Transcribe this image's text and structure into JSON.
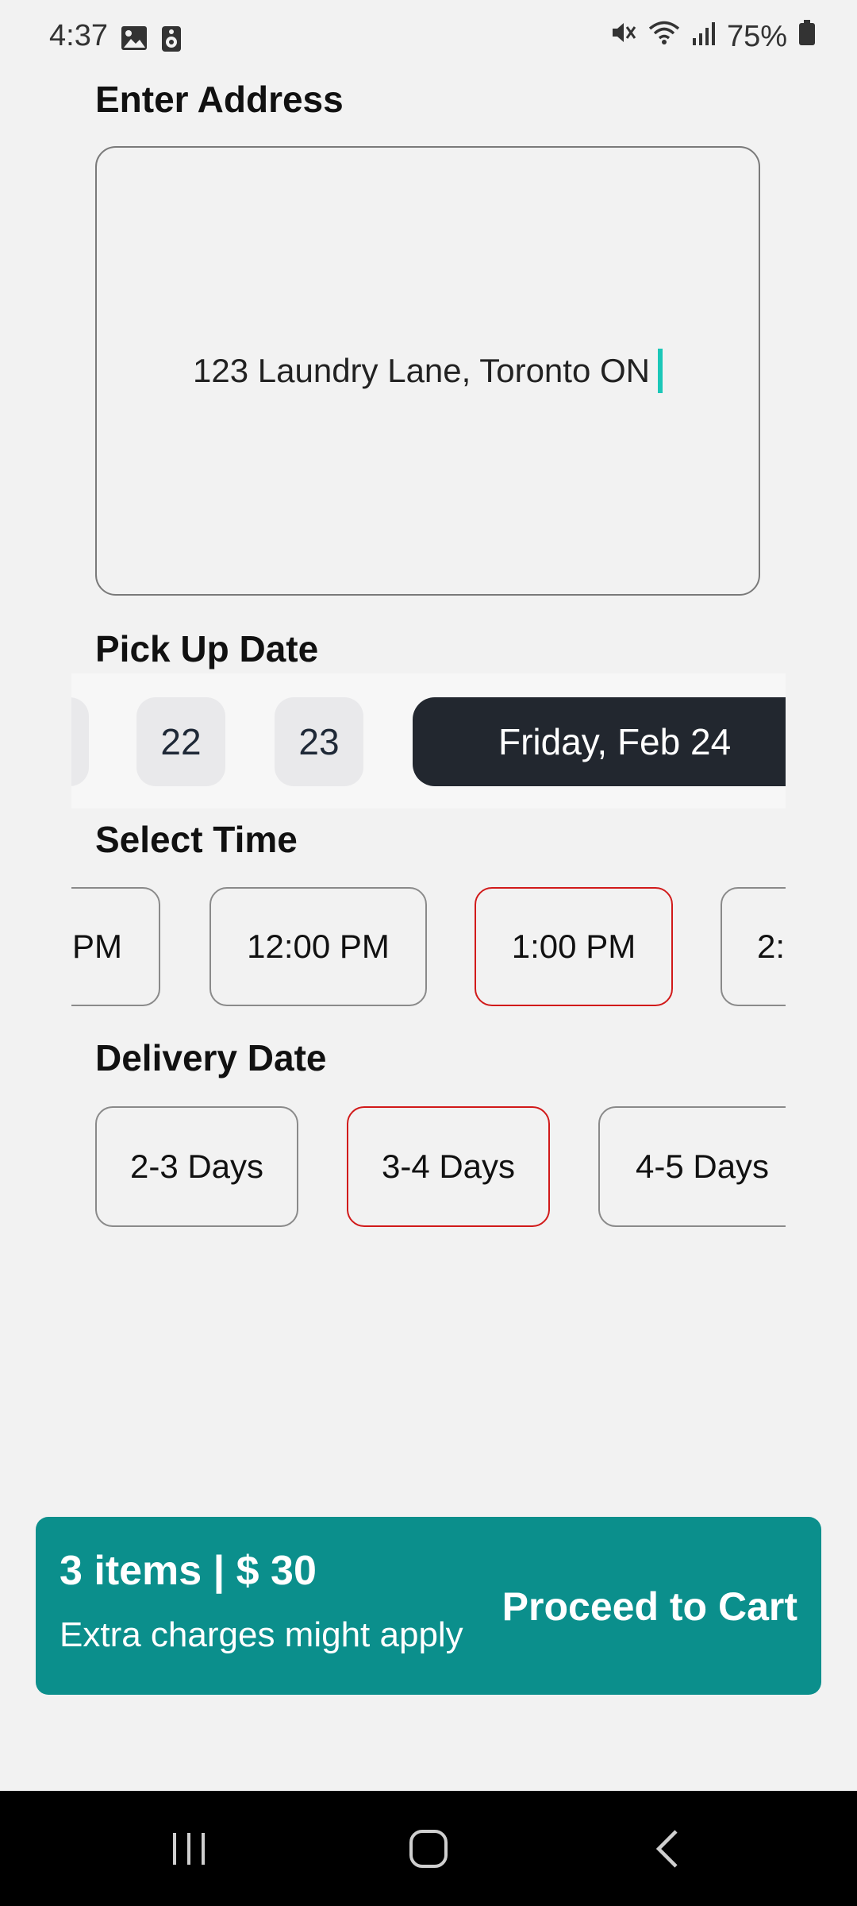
{
  "status_bar": {
    "time": "4:37",
    "battery": "75%",
    "icons_left": [
      "gallery-icon",
      "speaker-icon"
    ],
    "icons_right": [
      "mute-icon",
      "wifi-icon",
      "signal-icon",
      "battery-icon"
    ]
  },
  "address": {
    "title": "Enter Address",
    "value": "123 Laundry Lane, Toronto ON"
  },
  "pickup": {
    "title": "Pick Up Date",
    "days": [
      "",
      "22",
      "23"
    ],
    "selected": "Friday, Feb 24"
  },
  "time": {
    "title": "Select Time",
    "slots": [
      "PM",
      "12:00 PM",
      "1:00 PM",
      "2:"
    ],
    "selected_index": 2
  },
  "delivery": {
    "title": "Delivery Date",
    "options": [
      "2-3 Days",
      "3-4 Days",
      "4-5 Days"
    ],
    "selected_index": 1
  },
  "cart": {
    "summary": "3 items | $ 30",
    "note": "Extra charges might apply",
    "action": "Proceed to Cart"
  },
  "colors": {
    "accent": "#0b8f8c",
    "selected_border": "#d11a1a",
    "selected_day_bg": "#22272f",
    "caret": "#1cc7b8"
  },
  "nav": {
    "icons": [
      "recents-icon",
      "home-icon",
      "back-icon"
    ]
  }
}
